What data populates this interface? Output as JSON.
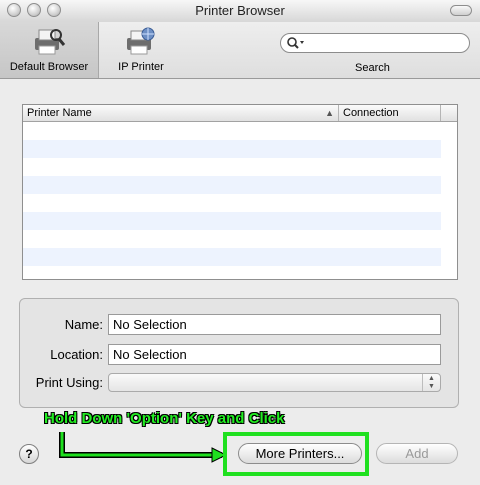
{
  "window": {
    "title": "Printer Browser"
  },
  "toolbar": {
    "items": [
      {
        "label": "Default Browser",
        "icon": "default-browser-icon"
      },
      {
        "label": "IP Printer",
        "icon": "ip-printer-icon"
      }
    ],
    "search_label": "Search",
    "search_value": ""
  },
  "table": {
    "columns": [
      "Printer Name",
      "Connection"
    ],
    "rows": []
  },
  "info": {
    "name_label": "Name:",
    "name_value": "No Selection",
    "location_label": "Location:",
    "location_value": "No Selection",
    "print_using_label": "Print Using:",
    "print_using_value": ""
  },
  "buttons": {
    "help": "?",
    "more_printers": "More Printers...",
    "add": "Add"
  },
  "annotation": {
    "text": "Hold Down 'Option' Key and Click",
    "color": "#22ee22"
  }
}
